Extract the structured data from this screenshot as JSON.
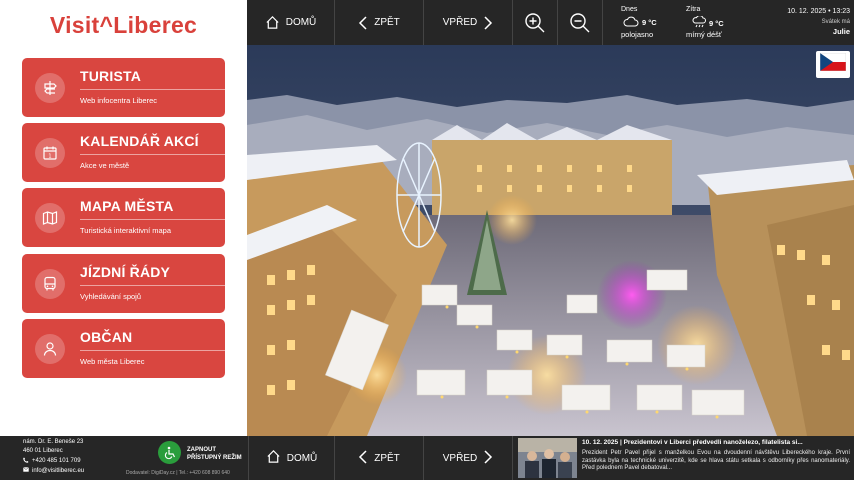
{
  "brand": {
    "logo_text": "Visit^Liberec",
    "accent": "#d9413b"
  },
  "menu": [
    {
      "title": "TURISTA",
      "subtitle": "Web infocentra Liberec",
      "icon": "signpost-icon"
    },
    {
      "title": "KALENDÁŘ AKCÍ",
      "subtitle": "Akce ve městě",
      "icon": "calendar-icon"
    },
    {
      "title": "MAPA MĚSTA",
      "subtitle": "Turistická interaktivní mapa",
      "icon": "map-icon"
    },
    {
      "title": "JÍZDNÍ ŘÁDY",
      "subtitle": "Vyhledávání spojů",
      "icon": "bus-icon"
    },
    {
      "title": "OBČAN",
      "subtitle": "Web města Liberec",
      "icon": "person-icon"
    }
  ],
  "topbar": {
    "home": "DOMŮ",
    "back": "ZPĚT",
    "forward": "VPŘED",
    "zoom_in_icon": "zoom-in-icon",
    "zoom_out_icon": "zoom-out-icon"
  },
  "weather": {
    "today_label": "Dnes",
    "today_temp": "9 °C",
    "today_desc": "polojasno",
    "tomorrow_label": "Zítra",
    "tomorrow_temp": "9 °C",
    "tomorrow_desc": "mírný déšť",
    "datetime": "10. 12. 2025 • 13:23",
    "nameday_label": "Svátek má",
    "nameday": "Julie"
  },
  "language": {
    "flag": "czech-flag-icon"
  },
  "bottombar": {
    "address_line1": "nám. Dr. E. Beneše 23",
    "address_line2": "460 01 Liberec",
    "phone": "+420 485 101 709",
    "email": "info@visitliberec.eu",
    "access_line1": "ZAPNOUT",
    "access_line2": "PŘÍSTUPNÝ REŽIM",
    "supplier": "Dodavatel: DigiDay.cz | Tel.: +420 608 890 640",
    "home": "DOMŮ",
    "back": "ZPĚT",
    "forward": "VPŘED"
  },
  "news": {
    "headline": "10. 12. 2025 | Prezidentovi v Liberci předvedli nanoželezo, filatelista si...",
    "body": "Prezident Petr Pavel přijel s manželkou Evou na dvoudenní návštěvu Libereckého kraje. První zastávka byla na technické univerzitě, kde se hlava státu setkala s odborníky přes nanomateriály. Před polednem Pavel debatoval..."
  }
}
